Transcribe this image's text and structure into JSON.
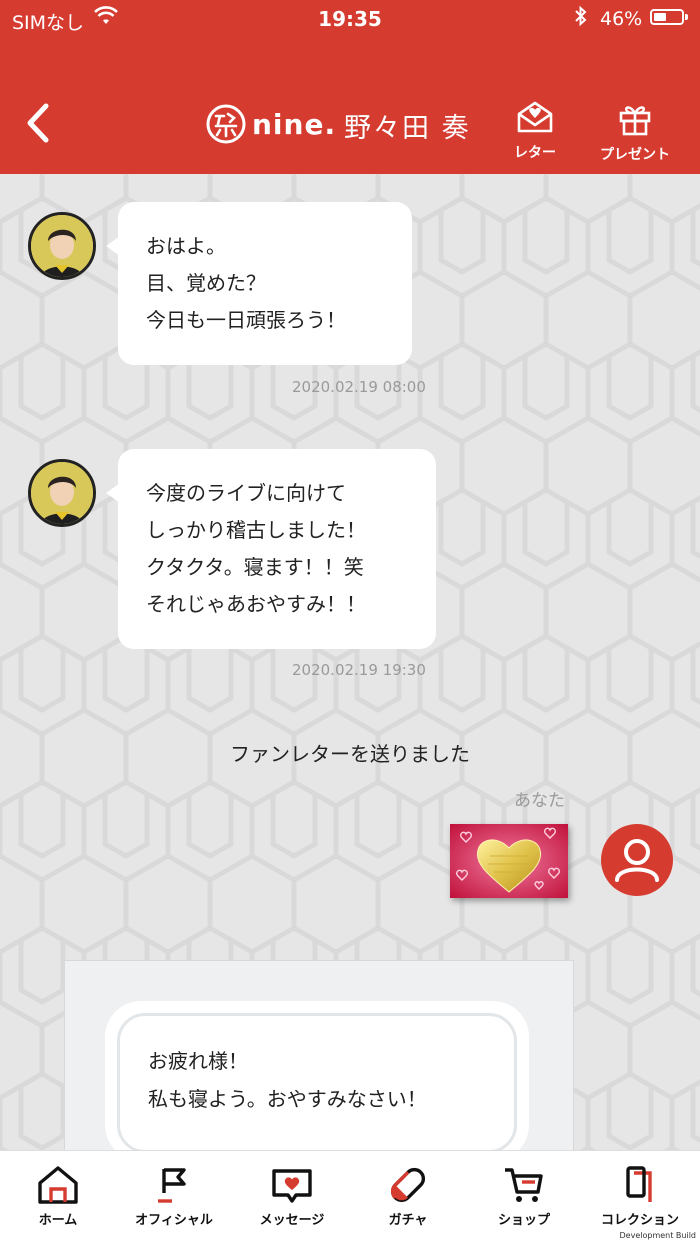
{
  "status_bar": {
    "carrier": "SIMなし",
    "time": "19:35",
    "battery_percent": "46%",
    "battery_level": 0.46
  },
  "header": {
    "brand": "nine.",
    "character_name": "野々田 奏",
    "letter_label": "レター",
    "present_label": "プレゼント"
  },
  "messages": [
    {
      "lines": [
        "おはよ。",
        "目、覚めた？",
        "今日も一日頑張ろう！"
      ],
      "timestamp": "2020.02.19 08:00"
    },
    {
      "lines": [
        "今度のライブに向けて",
        "しっかり稽古しました！",
        "クタクタ。寝ます！！笑",
        "それじゃあおやすみ！！"
      ],
      "timestamp": "2020.02.19 19:30"
    }
  ],
  "system_notice": "ファンレターを送りました",
  "sender_label": "あなた",
  "compose": {
    "lines": [
      "お疲れ様！",
      "私も寝よう。おやすみなさい！"
    ]
  },
  "tabs": [
    {
      "label": "ホーム"
    },
    {
      "label": "オフィシャル"
    },
    {
      "label": "メッセージ"
    },
    {
      "label": "ガチャ"
    },
    {
      "label": "ショップ"
    },
    {
      "label": "コレクション"
    }
  ],
  "footer_note": "Development Build",
  "colors": {
    "brand_red": "#d63b30",
    "chat_background": "#e6e6e6",
    "bubble": "#ffffff"
  }
}
